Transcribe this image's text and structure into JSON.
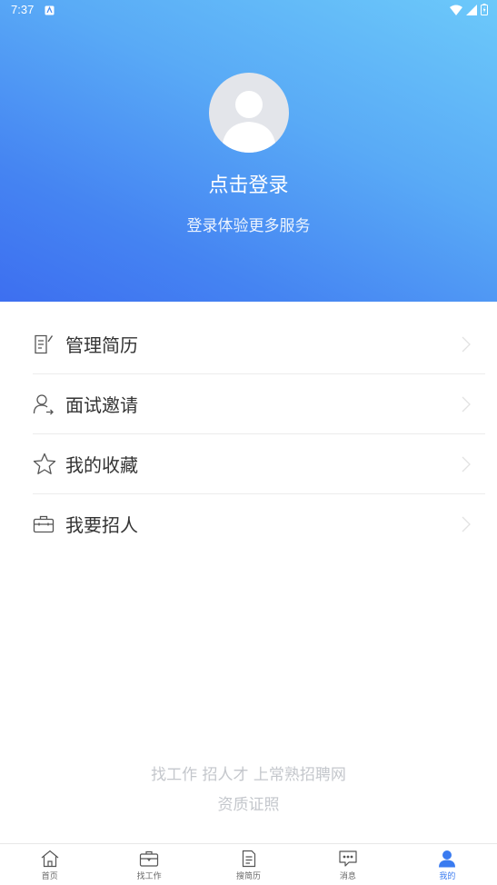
{
  "status_bar": {
    "time": "7:37"
  },
  "profile": {
    "login_title": "点击登录",
    "login_subtitle": "登录体验更多服务"
  },
  "menu": {
    "items": [
      {
        "label": "管理简历",
        "icon": "resume-edit-icon"
      },
      {
        "label": "面试邀请",
        "icon": "user-arrow-icon"
      },
      {
        "label": "我的收藏",
        "icon": "star-icon"
      },
      {
        "label": "我要招人",
        "icon": "briefcase-icon"
      }
    ]
  },
  "footer": {
    "slogan": "找工作 招人才 上常熟招聘网",
    "certificate": "资质证照"
  },
  "tabbar": {
    "items": [
      {
        "label": "首页",
        "icon": "home-icon"
      },
      {
        "label": "找工作",
        "icon": "briefcase-icon"
      },
      {
        "label": "搜简历",
        "icon": "document-icon"
      },
      {
        "label": "消息",
        "icon": "chat-icon"
      },
      {
        "label": "我的",
        "icon": "user-icon"
      }
    ],
    "active_index": 4
  },
  "colors": {
    "accent": "#3a7bf0",
    "hero_gradient_start": "#6cc9fa",
    "hero_gradient_end": "#3d6ff0",
    "footer_text": "#c4c7cc"
  }
}
